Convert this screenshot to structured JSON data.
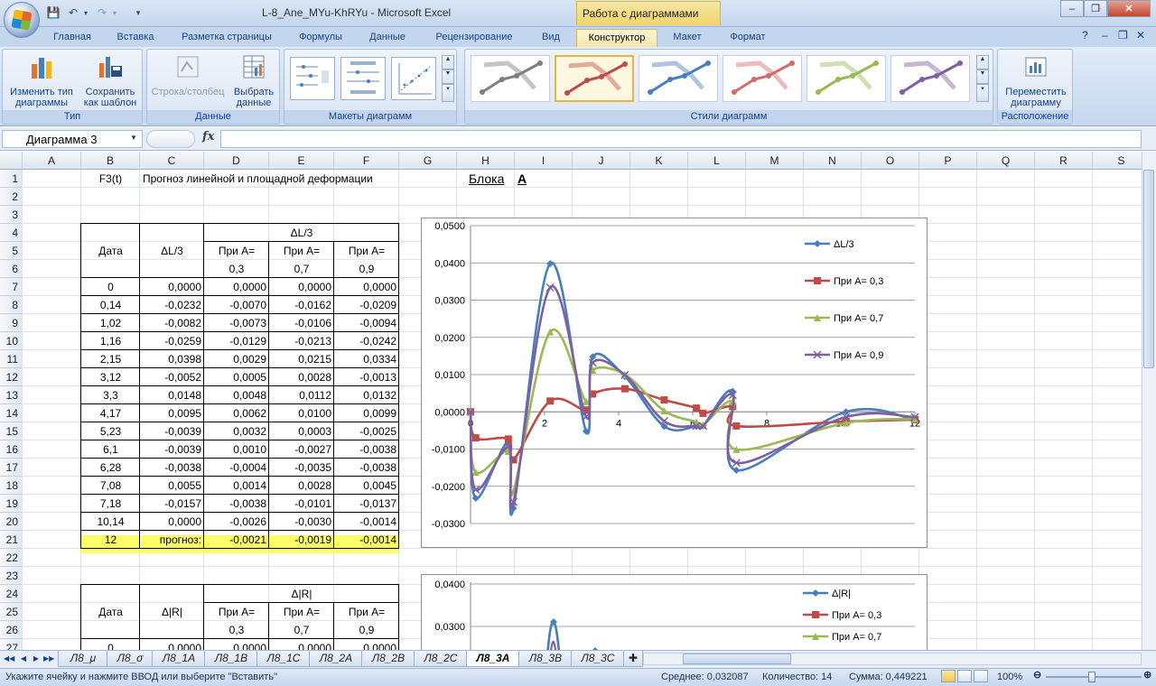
{
  "window": {
    "title": "L-8_Ane_MYu-KhRYu  -  Microsoft Excel",
    "context_tab_title": "Работа с диаграммами",
    "controls": [
      "–",
      "❐",
      "✕"
    ]
  },
  "ribbon": {
    "tabs": [
      "Главная",
      "Вставка",
      "Разметка страницы",
      "Формулы",
      "Данные",
      "Рецензирование",
      "Вид",
      "Конструктор",
      "Макет",
      "Формат"
    ],
    "active_tab": "Конструктор",
    "groups": {
      "type": {
        "label": "Тип",
        "change_type_l1": "Изменить тип",
        "change_type_l2": "диаграммы",
        "save_template_l1": "Сохранить",
        "save_template_l2": "как шаблон"
      },
      "data": {
        "label": "Данные",
        "row_col": "Строка/столбец",
        "select_data_l1": "Выбрать",
        "select_data_l2": "данные"
      },
      "layouts": {
        "label": "Макеты диаграмм"
      },
      "styles": {
        "label": "Стили диаграмм"
      },
      "location": {
        "label": "Расположение",
        "move_l1": "Переместить",
        "move_l2": "диаграмму"
      }
    }
  },
  "formula_bar": {
    "name_box": "Диаграмма 3",
    "fx": "fx",
    "formula": ""
  },
  "columns": [
    "A",
    "B",
    "C",
    "D",
    "E",
    "F",
    "G",
    "H",
    "I",
    "J",
    "K",
    "L",
    "M",
    "N",
    "O",
    "P",
    "Q",
    "R",
    "S"
  ],
  "rows": [
    "1",
    "2",
    "3",
    "4",
    "5",
    "6",
    "7",
    "8",
    "9",
    "10",
    "11",
    "12",
    "13",
    "14",
    "15",
    "16",
    "17",
    "18",
    "19",
    "20",
    "21",
    "22",
    "23",
    "24",
    "25",
    "26",
    "27"
  ],
  "sheet": {
    "b1": "F3(t)",
    "c1": "Прогноз линейной и площадной  деформации",
    "h1": "Блока",
    "i1": "А",
    "table1": {
      "group_header": "ΔL/3",
      "h_date": "Дата",
      "h_dl": "ΔL/3",
      "h_a03_l1": "При А=",
      "h_a03_l2": "0,3",
      "h_a07_l1": "При А=",
      "h_a07_l2": "0,7",
      "h_a09_l1": "При А=",
      "h_a09_l2": "0,9",
      "rows": [
        [
          "0",
          "0,0000",
          "0,0000",
          "0,0000",
          "0,0000"
        ],
        [
          "0,14",
          "-0,0232",
          "-0,0070",
          "-0,0162",
          "-0,0209"
        ],
        [
          "1,02",
          "-0,0082",
          "-0,0073",
          "-0,0106",
          "-0,0094"
        ],
        [
          "1,16",
          "-0,0259",
          "-0,0129",
          "-0,0213",
          "-0,0242"
        ],
        [
          "2,15",
          "0,0398",
          "0,0029",
          "0,0215",
          "0,0334"
        ],
        [
          "3,12",
          "-0,0052",
          "0,0005",
          "0,0028",
          "-0,0013"
        ],
        [
          "3,3",
          "0,0148",
          "0,0048",
          "0,0112",
          "0,0132"
        ],
        [
          "4,17",
          "0,0095",
          "0,0062",
          "0,0100",
          "0,0099"
        ],
        [
          "5,23",
          "-0,0039",
          "0,0032",
          "0,0003",
          "-0,0025"
        ],
        [
          "6,1",
          "-0,0039",
          "0,0010",
          "-0,0027",
          "-0,0038"
        ],
        [
          "6,28",
          "-0,0038",
          "-0,0004",
          "-0,0035",
          "-0,0038"
        ],
        [
          "7,08",
          "0,0055",
          "0,0014",
          "0,0028",
          "0,0045"
        ],
        [
          "7,18",
          "-0,0157",
          "-0,0038",
          "-0,0101",
          "-0,0137"
        ],
        [
          "10,14",
          "0,0000",
          "-0,0026",
          "-0,0030",
          "-0,0014"
        ]
      ],
      "forecast": [
        "12",
        "прогноз:",
        "-0,0021",
        "-0,0019",
        "-0,0014"
      ]
    },
    "table2": {
      "group_header": "Δ|R|",
      "h_date": "Дата",
      "h_dr": "Δ|R|",
      "h_a03_l1": "При А=",
      "h_a03_l2": "0,3",
      "h_a07_l1": "При А=",
      "h_a07_l2": "0,7",
      "h_a09_l1": "При А=",
      "h_a09_l2": "0,9",
      "row27": [
        "0",
        "0,0000",
        "0,0000",
        "0,0000",
        "0,0000"
      ]
    }
  },
  "chart_data": [
    {
      "type": "line",
      "x": [
        0,
        0.14,
        1.02,
        1.16,
        2.15,
        3.12,
        3.3,
        4.17,
        5.23,
        6.1,
        6.28,
        7.08,
        7.18,
        10.14,
        12
      ],
      "series": [
        {
          "name": "ΔL/3",
          "color": "#4a7ebb",
          "marker": "diamond",
          "values": [
            0.0,
            -0.0232,
            -0.0082,
            -0.0259,
            0.0398,
            -0.0052,
            0.0148,
            0.0095,
            -0.0039,
            -0.0039,
            -0.0038,
            0.0055,
            -0.0157,
            0.0,
            -0.0021
          ]
        },
        {
          "name": "При А= 0,3",
          "color": "#be4b48",
          "marker": "square",
          "values": [
            0.0,
            -0.007,
            -0.0073,
            -0.0129,
            0.0029,
            0.0005,
            0.0048,
            0.0062,
            0.0032,
            0.001,
            -0.0004,
            0.0014,
            -0.0038,
            -0.0026,
            -0.0021
          ]
        },
        {
          "name": "При А= 0,7",
          "color": "#98b954",
          "marker": "triangle",
          "values": [
            0.0,
            -0.0162,
            -0.0106,
            -0.0213,
            0.0215,
            0.0028,
            0.0112,
            0.01,
            0.0003,
            -0.0027,
            -0.0035,
            0.0028,
            -0.0101,
            -0.003,
            -0.0019
          ]
        },
        {
          "name": "При А= 0,9",
          "color": "#7d60a0",
          "marker": "x",
          "values": [
            0.0,
            -0.0209,
            -0.0094,
            -0.0242,
            0.0334,
            -0.0013,
            0.0132,
            0.0099,
            -0.0025,
            -0.0038,
            -0.0038,
            0.0045,
            -0.0137,
            -0.0014,
            -0.0014
          ]
        }
      ],
      "xlim": [
        0,
        12
      ],
      "ylim": [
        -0.03,
        0.05
      ],
      "x_ticks": [
        "0",
        "2",
        "4",
        "6",
        "8",
        "10",
        "12"
      ],
      "y_ticks": [
        "-0,0300",
        "-0,0200",
        "-0,0100",
        "0,0000",
        "0,0100",
        "0,0200",
        "0,0300",
        "0,0400",
        "0,0500"
      ],
      "grid": true,
      "legend": "right"
    },
    {
      "type": "line",
      "series": [
        {
          "name": "Δ|R|",
          "color": "#4a7ebb",
          "marker": "diamond"
        },
        {
          "name": "При А= 0,3",
          "color": "#be4b48",
          "marker": "square"
        },
        {
          "name": "При А= 0,7",
          "color": "#98b954",
          "marker": "triangle"
        }
      ],
      "y_ticks": [
        "0,0300",
        "0,0400"
      ],
      "grid": true,
      "legend": "right"
    }
  ],
  "sheet_tabs": [
    "Л8_μ",
    "Л8_σ",
    "Л8_1А",
    "Л8_1В",
    "Л8_1С",
    "Л8_2А",
    "Л8_2В",
    "Л8_2С",
    "Л8_3А",
    "Л8_3В",
    "Л8_3С"
  ],
  "active_sheet": "Л8_3А",
  "status": {
    "message": "Укажите ячейку и нажмите ВВОД или выберите \"Вставить\"",
    "average": "Среднее: 0,032087",
    "count": "Количество: 14",
    "sum": "Сумма: 0,449221",
    "zoom": "100%"
  }
}
